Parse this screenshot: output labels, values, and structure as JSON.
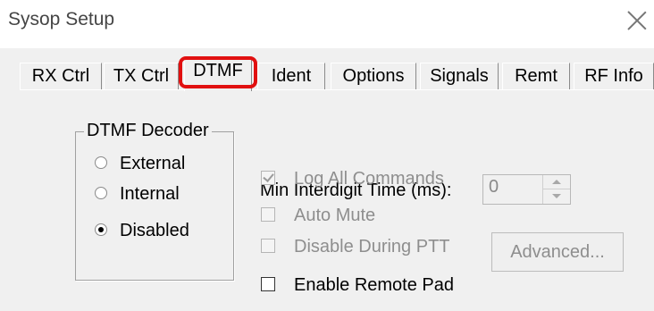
{
  "window": {
    "title": "Sysop Setup"
  },
  "tabs": [
    {
      "label": "RX Ctrl",
      "active": false
    },
    {
      "label": "TX Ctrl",
      "active": false
    },
    {
      "label": "DTMF",
      "active": true
    },
    {
      "label": "Ident",
      "active": false
    },
    {
      "label": "Options",
      "active": false
    },
    {
      "label": "Signals",
      "active": false
    },
    {
      "label": "Remt",
      "active": false
    },
    {
      "label": "RF Info",
      "active": false
    }
  ],
  "decoder_group": {
    "legend": "DTMF Decoder",
    "options": [
      {
        "label": "External",
        "selected": false
      },
      {
        "label": "Internal",
        "selected": false
      },
      {
        "label": "Disabled",
        "selected": true
      }
    ]
  },
  "interdigit": {
    "label": "Min Interdigit Time (ms):",
    "value": "0"
  },
  "checkboxes": [
    {
      "label": "Log All Commands",
      "checked": true,
      "enabled": false
    },
    {
      "label": "Auto Mute",
      "checked": false,
      "enabled": false
    },
    {
      "label": "Disable During PTT",
      "checked": false,
      "enabled": false
    },
    {
      "label": "Enable Remote Pad",
      "checked": false,
      "enabled": true
    }
  ],
  "advanced_button": {
    "label": "Advanced...",
    "enabled": false
  },
  "colors": {
    "highlight": "#e11010",
    "dialog_bg": "#f0f0f0",
    "disabled_text": "#8e8e8e"
  },
  "icons": {
    "close": "close-icon"
  }
}
